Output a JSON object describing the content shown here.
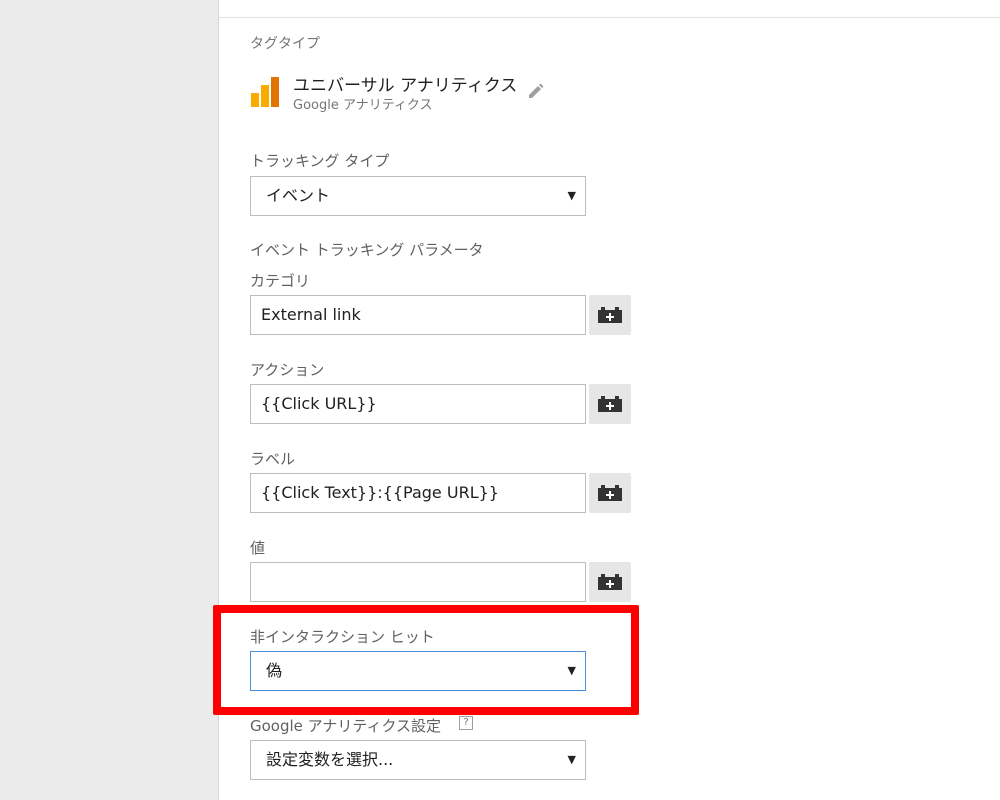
{
  "tag_type": {
    "section_label": "タグタイプ",
    "name": "ユニバーサル アナリティクス",
    "provider": "Google アナリティクス",
    "logo_icon": "google-analytics-logo-icon",
    "edit_icon": "pencil-icon"
  },
  "tracking_type": {
    "label": "トラッキング タイプ",
    "selected": "イベント"
  },
  "event_params": {
    "section_label": "イベント トラッキング パラメータ",
    "category": {
      "label": "カテゴリ",
      "value": "External link"
    },
    "action": {
      "label": "アクション",
      "value": "{{Click URL}}"
    },
    "event_label": {
      "label": "ラベル",
      "value": "{{Click Text}}:{{Page URL}}"
    },
    "value": {
      "label": "値",
      "value": ""
    },
    "variable_button_icon": "variable-brick-icon"
  },
  "non_interaction_hit": {
    "label": "非インタラクション ヒット",
    "selected": "偽"
  },
  "ga_settings": {
    "label": "Google アナリティクス設定",
    "help": "?",
    "selected": "設定変数を選択..."
  },
  "colors": {
    "highlight": "#ff0000",
    "logo_light": "#f9ab00",
    "logo_dark": "#e37400",
    "focus_border": "#4a90d9"
  }
}
